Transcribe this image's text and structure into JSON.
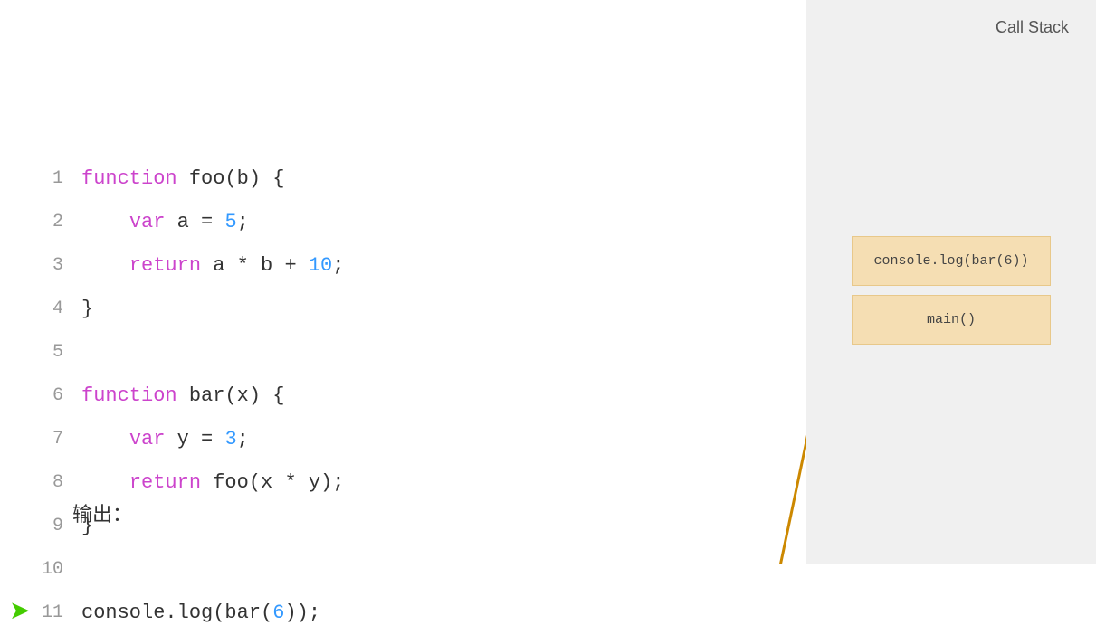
{
  "code": {
    "lines": [
      {
        "num": 1,
        "tokens": [
          {
            "t": "kw",
            "v": "function"
          },
          {
            "t": "plain",
            "v": " foo(b) {"
          }
        ],
        "arrow": null
      },
      {
        "num": 2,
        "tokens": [
          {
            "t": "plain",
            "v": "    "
          },
          {
            "t": "kw",
            "v": "var"
          },
          {
            "t": "plain",
            "v": " a "
          },
          {
            "t": "punc",
            "v": "="
          },
          {
            "t": "plain",
            "v": " "
          },
          {
            "t": "num",
            "v": "5"
          },
          {
            "t": "plain",
            "v": ";"
          }
        ],
        "arrow": null
      },
      {
        "num": 3,
        "tokens": [
          {
            "t": "plain",
            "v": "    "
          },
          {
            "t": "kw",
            "v": "return"
          },
          {
            "t": "plain",
            "v": " a "
          },
          {
            "t": "plain",
            "v": "* b + "
          },
          {
            "t": "num",
            "v": "10"
          },
          {
            "t": "plain",
            "v": ";"
          }
        ],
        "arrow": null
      },
      {
        "num": 4,
        "tokens": [
          {
            "t": "plain",
            "v": "}"
          }
        ],
        "arrow": null
      },
      {
        "num": 5,
        "tokens": [],
        "arrow": null
      },
      {
        "num": 6,
        "tokens": [
          {
            "t": "kw",
            "v": "function"
          },
          {
            "t": "plain",
            "v": " bar(x) {"
          }
        ],
        "arrow": null
      },
      {
        "num": 7,
        "tokens": [
          {
            "t": "plain",
            "v": "    "
          },
          {
            "t": "kw",
            "v": "var"
          },
          {
            "t": "plain",
            "v": " y "
          },
          {
            "t": "punc",
            "v": "="
          },
          {
            "t": "plain",
            "v": " "
          },
          {
            "t": "num",
            "v": "3"
          },
          {
            "t": "plain",
            "v": ";"
          }
        ],
        "arrow": null
      },
      {
        "num": 8,
        "tokens": [
          {
            "t": "plain",
            "v": "    "
          },
          {
            "t": "kw",
            "v": "return"
          },
          {
            "t": "plain",
            "v": " foo(x * y);"
          }
        ],
        "arrow": null
      },
      {
        "num": 9,
        "tokens": [
          {
            "t": "plain",
            "v": "}"
          }
        ],
        "arrow": null
      },
      {
        "num": 10,
        "tokens": [],
        "arrow": null
      },
      {
        "num": 11,
        "tokens": [
          {
            "t": "plain",
            "v": "console.log(bar("
          },
          {
            "t": "num",
            "v": "6"
          },
          {
            "t": "plain",
            "v": "));"
          }
        ],
        "arrow": "green"
      }
    ]
  },
  "callStack": {
    "title": "Call Stack",
    "items": [
      {
        "label": "console.log(bar(6))"
      },
      {
        "label": "main()"
      }
    ]
  },
  "output": {
    "label": "输出："
  }
}
